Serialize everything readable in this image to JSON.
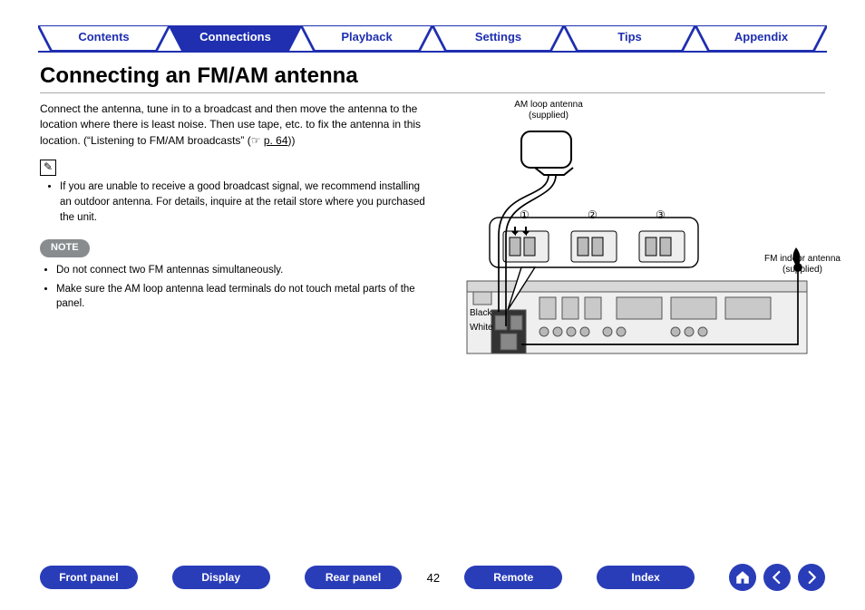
{
  "tabs": [
    {
      "label": "Contents",
      "active": false
    },
    {
      "label": "Connections",
      "active": true
    },
    {
      "label": "Playback",
      "active": false
    },
    {
      "label": "Settings",
      "active": false
    },
    {
      "label": "Tips",
      "active": false
    },
    {
      "label": "Appendix",
      "active": false
    }
  ],
  "heading": "Connecting an FM/AM antenna",
  "intro": "Connect the antenna, tune in to a broadcast and then move the antenna to the location where there is least noise. Then use tape, etc. to fix the antenna in this location. (“Listening to FM/AM broadcasts” (☞ ",
  "page_ref": "p. 64",
  "intro_tail": "))",
  "info_items": [
    "If you are unable to receive a good broadcast signal, we recommend installing an outdoor antenna. For details, inquire at the retail store where you purchased the unit."
  ],
  "note_label": "NOTE",
  "note_items": [
    "Do not connect two FM antennas simultaneously.",
    "Make sure the AM loop antenna lead terminals do not touch metal parts of the panel."
  ],
  "diagram": {
    "am_label_1": "AM loop antenna",
    "am_label_2": "(supplied)",
    "fm_label_1": "FM indoor antenna",
    "fm_label_2": "(supplied)",
    "markers": [
      "①",
      "②",
      "③"
    ],
    "color_black": "Black",
    "color_white": "White"
  },
  "bottom_buttons": [
    "Front panel",
    "Display",
    "Rear panel"
  ],
  "bottom_buttons_right": [
    "Remote",
    "Index"
  ],
  "page_number": "42"
}
